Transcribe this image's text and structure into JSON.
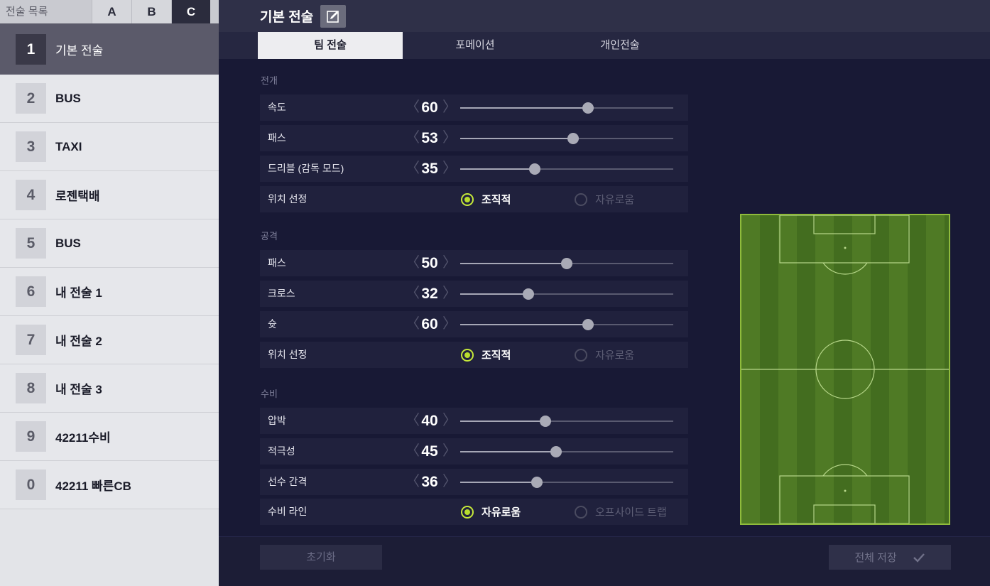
{
  "sidebar": {
    "title": "전술 목록",
    "presets": [
      "A",
      "B",
      "C"
    ],
    "active_preset": "C",
    "items": [
      {
        "num": "1",
        "label": "기본 전술"
      },
      {
        "num": "2",
        "label": "BUS"
      },
      {
        "num": "3",
        "label": "TAXI"
      },
      {
        "num": "4",
        "label": "로젠택배"
      },
      {
        "num": "5",
        "label": "BUS"
      },
      {
        "num": "6",
        "label": "내 전술 1"
      },
      {
        "num": "7",
        "label": "내 전술 2"
      },
      {
        "num": "8",
        "label": "내 전술 3"
      },
      {
        "num": "9",
        "label": "42211수비"
      },
      {
        "num": "0",
        "label": "42211 빠른CB"
      }
    ]
  },
  "header": {
    "title": "기본 전술",
    "edit_icon": "edit-icon"
  },
  "tabs": [
    "팀 전술",
    "포메이션",
    "개인전술"
  ],
  "sections": [
    {
      "title": "전개",
      "sliders": [
        {
          "name": "속도",
          "value": 60
        },
        {
          "name": "패스",
          "value": 53
        },
        {
          "name": "드리블 (감독 모드)",
          "value": 35
        }
      ],
      "radio": {
        "name": "위치 선정",
        "options": [
          "조직적",
          "자유로움"
        ],
        "selected": 0
      }
    },
    {
      "title": "공격",
      "sliders": [
        {
          "name": "패스",
          "value": 50
        },
        {
          "name": "크로스",
          "value": 32
        },
        {
          "name": "슛",
          "value": 60
        }
      ],
      "radio": {
        "name": "위치 선정",
        "options": [
          "조직적",
          "자유로움"
        ],
        "selected": 0
      }
    },
    {
      "title": "수비",
      "sliders": [
        {
          "name": "압박",
          "value": 40
        },
        {
          "name": "적극성",
          "value": 45
        },
        {
          "name": "선수 간격",
          "value": 36
        }
      ],
      "radio": {
        "name": "수비 라인",
        "options": [
          "자유로움",
          "오프사이드 트랩"
        ],
        "selected": 0
      }
    }
  ],
  "arrows": {
    "left": "〈",
    "right": "〉"
  },
  "colors": {
    "accent": "#b8dd2d",
    "pitch": "#4f7a25"
  },
  "footer": {
    "reset_label": "초기화",
    "save_label": "전체 저장",
    "save_icon": "check-icon"
  }
}
